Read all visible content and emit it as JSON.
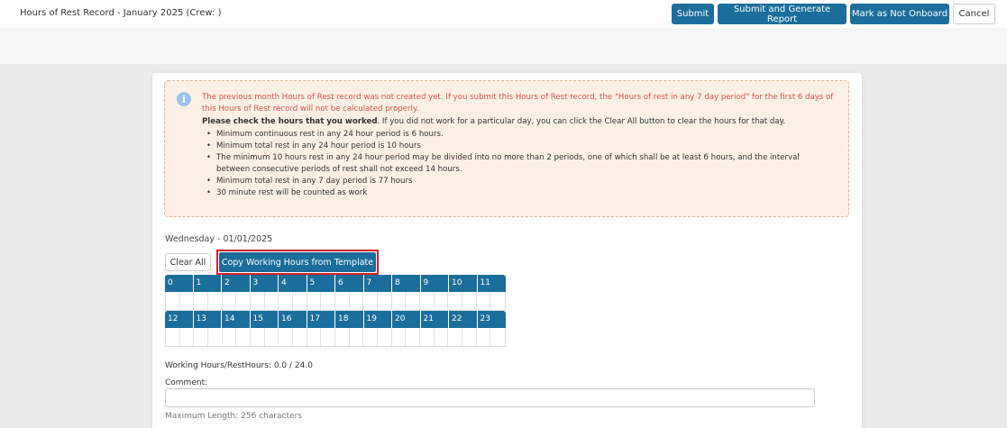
{
  "header": {
    "title": "Hours of Rest Record - January 2025 (Crew: )",
    "buttons": {
      "submit": "Submit",
      "submit_report": "Submit and Generate Report",
      "not_onboard": "Mark as Not Onboard",
      "cancel": "Cancel"
    }
  },
  "notice": {
    "icon": "info-icon",
    "warning": "The previous month Hours of Rest record was not created yet. If you submit this Hours of Rest record, the \"Hours of rest in any 7 day period\" for the first 6 days of this Hours of Rest record will not be calculated properly.",
    "check_bold": "Please check the hours that you worked",
    "check_rest": ". If you did not work for a particular day, you can click the Clear All button to clear the hours for that day.",
    "rules": [
      "Minimum continuous rest in any 24 hour period is 6 hours.",
      "Minimum total rest in any 24 hour period is 10 hours",
      "The minimum 10 hours rest in any 24 hour period may be divided into no more than 2 periods, one of which shall be at least 6 hours, and the interval between consecutive periods of rest shall not exceed 14 hours.",
      "Minimum total rest in any 7 day period is 77 hours",
      "30 minute rest will be counted as work"
    ]
  },
  "day": {
    "label": "Wednesday - 01/01/2025",
    "clear_all": "Clear All",
    "copy_template": "Copy Working Hours from Template",
    "hours_row1": [
      "0",
      "1",
      "2",
      "3",
      "4",
      "5",
      "6",
      "7",
      "8",
      "9",
      "10",
      "11"
    ],
    "hours_row2": [
      "12",
      "13",
      "14",
      "15",
      "16",
      "17",
      "18",
      "19",
      "20",
      "21",
      "22",
      "23"
    ],
    "summary": "Working Hours/RestHours: 0.0 / 24.0",
    "comment_label": "Comment:",
    "comment_value": "",
    "max_length": "Maximum Length: 256 characters"
  },
  "colors": {
    "primary": "#1b6e9b",
    "warning_text": "#d9534f",
    "notice_bg": "#fcf0e4",
    "highlight": "#d11f2a"
  }
}
